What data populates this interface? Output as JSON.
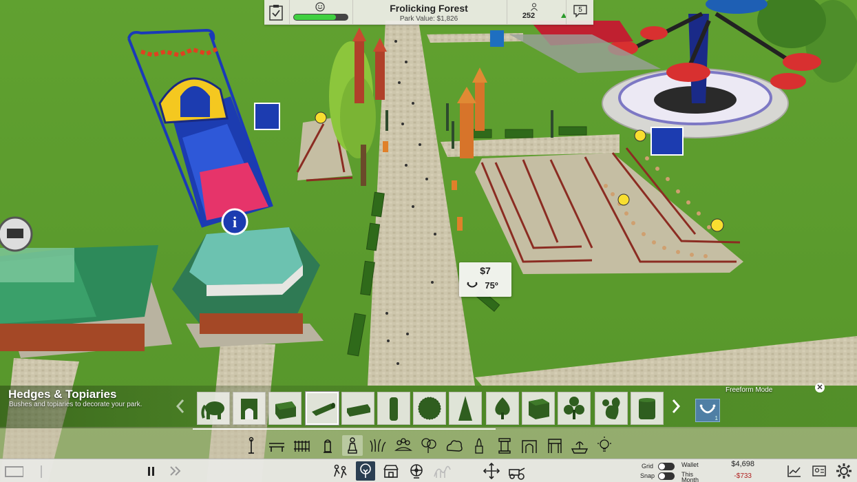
{
  "hud": {
    "park_name": "Frolicking Forest",
    "park_value": "Park Value: $1,826",
    "guests": "252",
    "messages": "5",
    "happiness": 0.78
  },
  "price_tooltip": {
    "price": "$7",
    "rating": "75º"
  },
  "scenery_panel": {
    "title": "Hedges & Topiaries",
    "subtitle": "Bushes and topiaries to decorate your park.",
    "mode": "Freeform Mode",
    "selected_index": 3,
    "items": [
      "elephant-topiary-icon",
      "hedge-archway-icon",
      "hedge-block-icon",
      "hedge-log-icon",
      "hedge-long-icon",
      "hedge-column-icon",
      "round-bush-icon",
      "cone-topiary-icon",
      "spade-topiary-icon",
      "cube-hedge-icon",
      "club-topiary-icon",
      "squirrel-topiary-icon",
      "cylinder-hedge-icon"
    ],
    "blueprint_count": "1",
    "categories": [
      "lamp-icon",
      "bench-icon",
      "fence-icon",
      "fire-hydrant-icon",
      "statue-icon",
      "grass-icon",
      "flower-bed-icon",
      "tree-icon",
      "bush-icon",
      "fountain-spray-icon",
      "pillar-icon",
      "arch-icon",
      "gate-icon",
      "fountain-icon",
      "light-bulb-icon"
    ],
    "selected_category": 4
  },
  "bottom_bar": {
    "grid_label": "Grid",
    "snap_label": "Snap",
    "wallet_label": "Wallet",
    "wallet_value": "$4,698",
    "month_label_1": "This",
    "month_label_2": "Month",
    "month_value": "-$733",
    "tools": [
      "path-tool-icon",
      "scenery-tool-icon",
      "shop-tool-icon",
      "ride-tool-icon",
      "coaster-tool-icon",
      "move-tool-icon",
      "terraform-tool-icon"
    ]
  },
  "colors": {
    "grass": "#5a9a2c",
    "path": "#c9c2a8",
    "hud_bg": "#eeeee8",
    "happiness_bar": "#40d040",
    "negative": "#b02020"
  }
}
